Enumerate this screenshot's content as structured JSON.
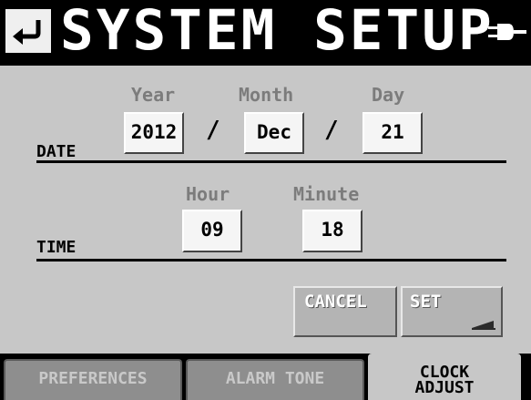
{
  "header": {
    "title": "SYSTEM SETUP",
    "back_icon": "return-arrow-icon",
    "power_icon": "ac-power-plug-icon"
  },
  "date": {
    "label": "DATE",
    "year_label": "Year",
    "month_label": "Month",
    "day_label": "Day",
    "year": "2012",
    "month": "Dec",
    "day": "21",
    "separator": "/"
  },
  "time": {
    "label": "TIME",
    "hour_label": "Hour",
    "minute_label": "Minute",
    "hour": "09",
    "minute": "18"
  },
  "buttons": {
    "cancel": "CANCEL",
    "set": "SET"
  },
  "tabs": [
    {
      "label": "PREFERENCES",
      "active": false
    },
    {
      "label": "ALARM TONE",
      "active": false
    },
    {
      "label_line1": "CLOCK",
      "label_line2": "ADJUST",
      "active": true
    }
  ],
  "colors": {
    "panel": "#c7c7c7",
    "header_bg": "#000000",
    "field_bg": "#f5f5f5",
    "button_bg": "#b4b4b4",
    "tab_inactive": "#8e8e8e"
  }
}
